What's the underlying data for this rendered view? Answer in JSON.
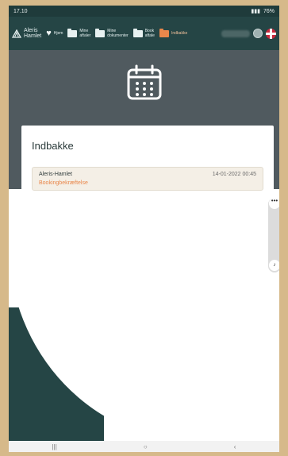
{
  "status_bar": {
    "time": "17.10",
    "battery": "76%"
  },
  "nav": {
    "logo": "Aleris\nHamlet",
    "items": [
      {
        "label": "Hjem",
        "icon": "heart-icon"
      },
      {
        "label": "Mine\naftaler",
        "icon": "folder-icon"
      },
      {
        "label": "Mine\ndokumenter",
        "icon": "folder-icon"
      },
      {
        "label": "Book\naftale",
        "icon": "folder-icon"
      },
      {
        "label": "Indbakke",
        "icon": "folder-icon",
        "active": true
      }
    ]
  },
  "inbox": {
    "title": "Indbakke",
    "messages": [
      {
        "sender": "Aleris-Hamlet",
        "date": "14-01-2022 00:45",
        "subject": "Bookingbekræftelse"
      }
    ]
  },
  "colors": {
    "header": "#254545",
    "hero": "#505a5f",
    "accent": "#e9874b"
  }
}
